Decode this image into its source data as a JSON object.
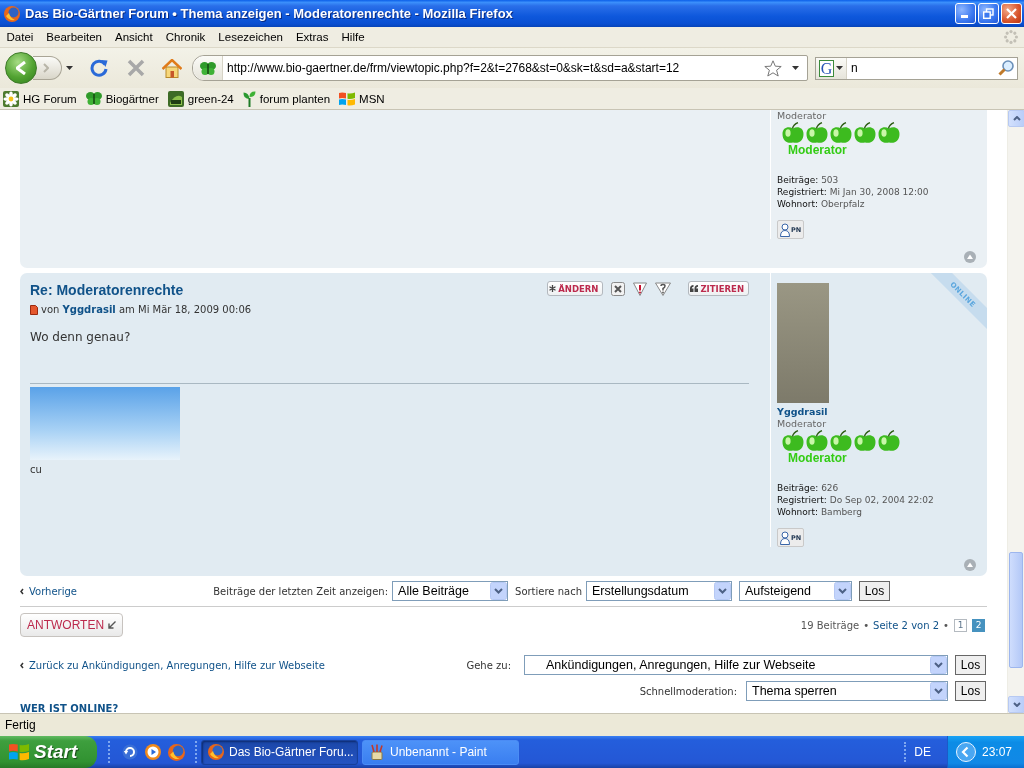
{
  "window": {
    "title": "Das Bio-Gärtner Forum • Thema anzeigen - Moderatorenrechte - Mozilla Firefox"
  },
  "menu": [
    "Datei",
    "Bearbeiten",
    "Ansicht",
    "Chronik",
    "Lesezeichen",
    "Extras",
    "Hilfe"
  ],
  "navigation": {
    "url": "http://www.bio-gaertner.de/frm/viewtopic.php?f=2&t=2768&st=0&sk=t&sd=a&start=12",
    "search_engine": "G",
    "search_value": "n"
  },
  "bookmarks": [
    "HG Forum",
    "Biogärtner",
    "green-24",
    "forum planten",
    "MSN"
  ],
  "previous_post": {
    "profile": {
      "rank": "Moderator",
      "rank_badge": "Moderator",
      "details": [
        {
          "label": "Beiträge:",
          "value": "503"
        },
        {
          "label": "Registriert:",
          "value": "Mi Jan 30, 2008 12:00"
        },
        {
          "label": "Wohnort:",
          "value": "Oberpfalz"
        }
      ],
      "pm_button": "PN"
    }
  },
  "post": {
    "title": "Re: Moderatorenrechte",
    "buttons": [
      {
        "kind": "edit",
        "label": "ÄNDERN"
      },
      {
        "kind": "delete"
      },
      {
        "kind": "report"
      },
      {
        "kind": "info"
      },
      {
        "kind": "quote",
        "label": "ZITIEREN"
      }
    ],
    "byline": {
      "prefix": "von",
      "author": "Yggdrasil",
      "date": "am Mi Mär 18, 2009 00:06"
    },
    "body": "Wo denn genau?",
    "signature": "cu",
    "online": true,
    "online_label": "ONLINE",
    "profile": {
      "username": "Yggdrasil",
      "rank": "Moderator",
      "rank_badge": "Moderator",
      "details": [
        {
          "label": "Beiträge:",
          "value": "626"
        },
        {
          "label": "Registriert:",
          "value": "Do Sep 02, 2004 22:02"
        },
        {
          "label": "Wohnort:",
          "value": "Bamberg"
        }
      ],
      "pm_button": "PN"
    }
  },
  "sort_bar": {
    "previous": "Vorherige",
    "filter_label": "Beiträge der letzten Zeit anzeigen:",
    "filter_value": "Alle Beiträge",
    "sort_label": "Sortiere nach",
    "sort_key": "Erstellungsdatum",
    "sort_direction": "Aufsteigend",
    "submit": "Los"
  },
  "pagination": {
    "reply": "ANTWORTEN",
    "count": "19 Beiträge",
    "separators": [
      "•",
      "•"
    ],
    "page_label": "Seite 2 von 2",
    "pages": [
      {
        "label": "1",
        "selected": false
      },
      {
        "label": "2",
        "selected": true
      }
    ]
  },
  "jump": {
    "back_link": "Zurück zu Ankündigungen, Anregungen, Hilfe zur Webseite",
    "jump_label": "Gehe zu:",
    "jump_value": "Ankündigungen, Anregungen, Hilfe zur Webseite",
    "jump_submit": "Los",
    "moderation_label": "Schnellmoderation:",
    "moderation_value": "Thema sperren",
    "moderation_submit": "Los"
  },
  "online_heading": "WER IST ONLINE?",
  "status_bar": {
    "text": "Fertig"
  },
  "taskbar": {
    "start": "Start",
    "tasks": [
      {
        "label": "Das Bio-Gärtner Foru...",
        "selected": true
      },
      {
        "label": "Unbenannt - Paint",
        "selected": false
      }
    ],
    "language": "DE",
    "clock": "23:07"
  }
}
